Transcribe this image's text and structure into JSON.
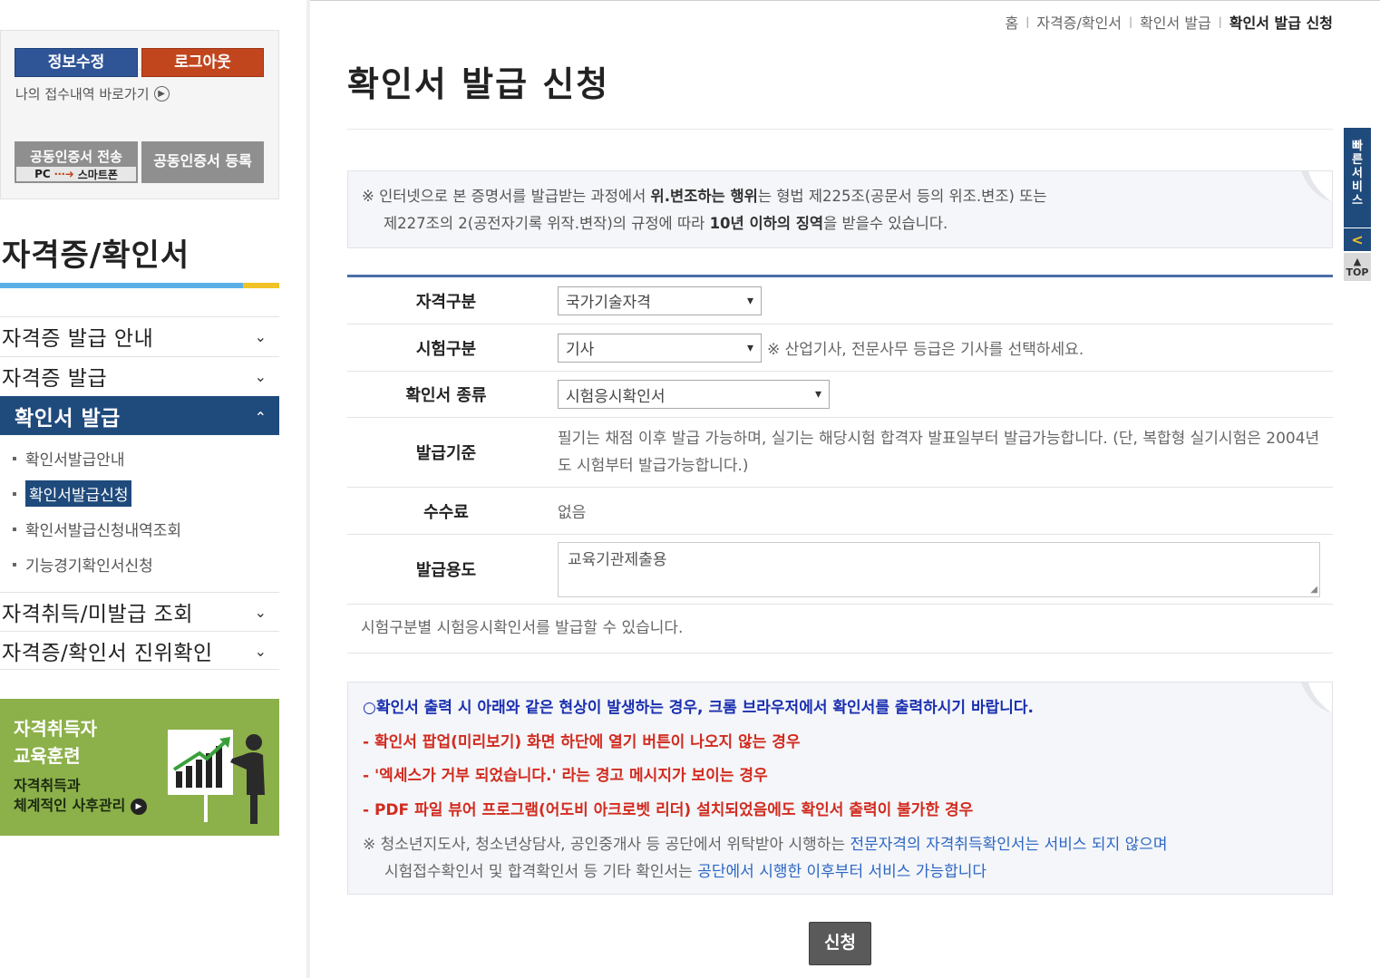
{
  "login_box": {
    "edit_info": "정보수정",
    "logout": "로그아웃",
    "my_receipts_link": "나의 접수내역 바로가기",
    "cert_send_line1": "공동인증서 전송",
    "cert_send_pc": "PC",
    "cert_send_arrow": "⋯➜",
    "cert_send_phone": "스마트폰",
    "cert_register": "공동인증서 등록"
  },
  "sidebar": {
    "title": "자격증/확인서",
    "menu": [
      {
        "label": "자격증 발급 안내",
        "chev": "⌄"
      },
      {
        "label": "자격증 발급",
        "chev": "⌄"
      },
      {
        "label": "확인서 발급",
        "chev": "⌃"
      },
      {
        "label": "자격취득/미발급 조회",
        "chev": "⌄"
      },
      {
        "label": "자격증/확인서 진위확인",
        "chev": "⌄"
      }
    ],
    "submenu": [
      "확인서발급안내",
      "확인서발급신청",
      "확인서발급신청내역조회",
      "기능경기확인서신청"
    ],
    "banner": {
      "line1": "자격취득자",
      "line2": "교육훈련",
      "line3": "자격취득과",
      "line4": "체계적인 사후관리"
    }
  },
  "breadcrumb": [
    "홈",
    "자격증/확인서",
    "확인서 발급",
    "확인서 발급 신청"
  ],
  "breadcrumb_sep": "|",
  "page_title": "확인서 발급 신청",
  "notice1": {
    "p1": "※ 인터넷으로 본 증명서를 발급받는 과정에서 ",
    "b1": "위.변조하는 행위",
    "p2": "는 형법 제225조(공문서 등의 위조.변조) 또는",
    "p3": "제227조의 2(공전자기록 위작.변작)의 규정에 따라 ",
    "b2": "10년 이하의 징역",
    "p4": "을 받을수 있습니다."
  },
  "form": {
    "qual_label": "자격구분",
    "qual_value": "국가기술자격",
    "exam_label": "시험구분",
    "exam_value": "기사",
    "exam_hint": "※ 산업기사, 전문사무 등급은 기사를 선택하세요.",
    "type_label": "확인서 종류",
    "type_value": "시험응시확인서",
    "basis_label": "발급기준",
    "basis_text": "필기는 채점 이후 발급 가능하며, 실기는 해당시험 합격자 발표일부터 발급가능합니다. (단, 복합형 실기시험은 2004년도 시험부터 발급가능합니다.)",
    "fee_label": "수수료",
    "fee_value": "없음",
    "purpose_label": "발급용도",
    "purpose_value": "교육기관제출용"
  },
  "under_note": "시험구분별 시험응시확인서를 발급할 수 있습니다.",
  "notice2": {
    "heading": "○확인서 출력 시 아래와 같은 현상이 발생하는 경우, 크롬 브라우저에서 확인서를 출력하시기 바랍니다.",
    "items": [
      "- 확인서 팝업(미리보기) 화면 하단에 열기 버튼이 나오지 않는 경우",
      "- '엑세스가 거부 되었습니다.' 라는 경고 메시지가 보이는 경우",
      "- PDF 파일 뷰어 프로그램(어도비 아크로벳 리더) 설치되었음에도 확인서 출력이 불가한 경우"
    ],
    "foot1a": "※ 청소년지도사, 청소년상담사, 공인중개사 등 공단에서 위탁받아 시행하는 ",
    "foot1b": "전문자격의 자격취득확인서는 서비스 되지 않으며",
    "foot2a": "시험접수확인서 및 합격확인서 등 기타 확인서는 ",
    "foot2b": "공단에서 시행한 이후부터 서비스 가능합니다"
  },
  "submit": "신청",
  "quick_service": "빠른서비스",
  "quick_arrow": "<",
  "top_label": "TOP",
  "colors": {
    "navy": "#1f4a7c",
    "accent_orange": "#c1461e",
    "notice_red": "#d22b1f",
    "notice_blue": "#1a2fb0",
    "banner_green": "#8cb04a"
  }
}
